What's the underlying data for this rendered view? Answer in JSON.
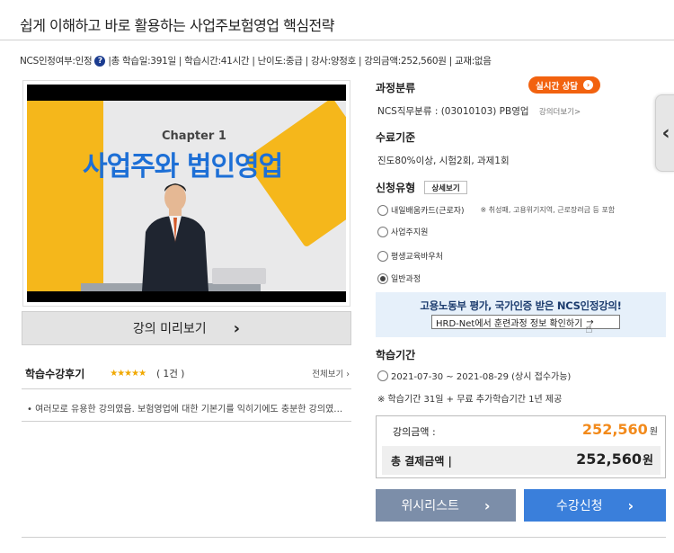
{
  "title": "쉽게 이해하고 바로 활용하는 사업주보험영업 핵심전략",
  "meta": {
    "ncs": "NCS인정여부:인정",
    "help_icon": "?",
    "rest": "|총 학습일:391일 | 학습시간:41시간 | 난이도:중급 | 강사:양정호 | 강의금액:252,560원 | 교재:없음"
  },
  "video": {
    "chapter": "Chapter 1",
    "chapter_title": "사업주와 법인영업"
  },
  "preview": {
    "label": "강의 미리보기",
    "chevron": "›"
  },
  "reviews": {
    "title": "학습수강후기",
    "stars": "★★★★★",
    "count": "( 1건 )",
    "see_all": "전체보기 ›",
    "item": "• 여러모로 유용한 강의였음. 보험영업에 대한 기본기를 익히기에도 충분한 강의였습니다."
  },
  "live_consult": {
    "label": "실시간 상담",
    "icon": "›"
  },
  "category": {
    "title": "과정분류",
    "text": "NCS직무분류 : (03010103) PB영업",
    "link": "강의더보기>"
  },
  "completion": {
    "title": "수료기준",
    "text": "진도80%이상, 시험2회, 과제1회"
  },
  "apply_type": {
    "title": "신청유형",
    "detail_label": "상세보기",
    "options": [
      {
        "label": "내일배움카드(근로자)",
        "note": "※ 취성패, 고용위기지역, 근로장려금 등 포함"
      },
      {
        "label": "사업주지원",
        "note": ""
      },
      {
        "label": "평생교육바우처",
        "note": ""
      },
      {
        "label": "일반과정",
        "note": ""
      }
    ],
    "selected_index": 3
  },
  "banner": {
    "top": "고용노동부 평가, 국가인증 받은 NCS인정강의!",
    "sub": "HRD-Net에서 훈련과정 정보 확인하기",
    "sub_suffix": "→"
  },
  "period": {
    "title": "학습기간",
    "option": "2021-07-30 ~ 2021-08-29 (상시 접수가능)",
    "note": "※ 학습기간 31일 + 무료 추가학습기간 1년 제공"
  },
  "price": {
    "label1": "강의금액 :",
    "value1": "252,560",
    "won1": "원",
    "label2": "총 결제금액  |",
    "value2": "252,560",
    "won2": "원"
  },
  "buttons": {
    "wishlist": "위시리스트",
    "apply": "수강신청",
    "chevron": "›"
  },
  "side_tab": {
    "icon": "‹"
  },
  "colors": {
    "accent_orange": "#f2620f",
    "price_orange": "#f28a1b",
    "wish_btn": "#7c8ea9",
    "apply_btn": "#3a7fdb",
    "banner_bg": "#e6f0fa",
    "video_title_blue": "#1d6fd6",
    "video_yellow": "#f5b71b"
  }
}
